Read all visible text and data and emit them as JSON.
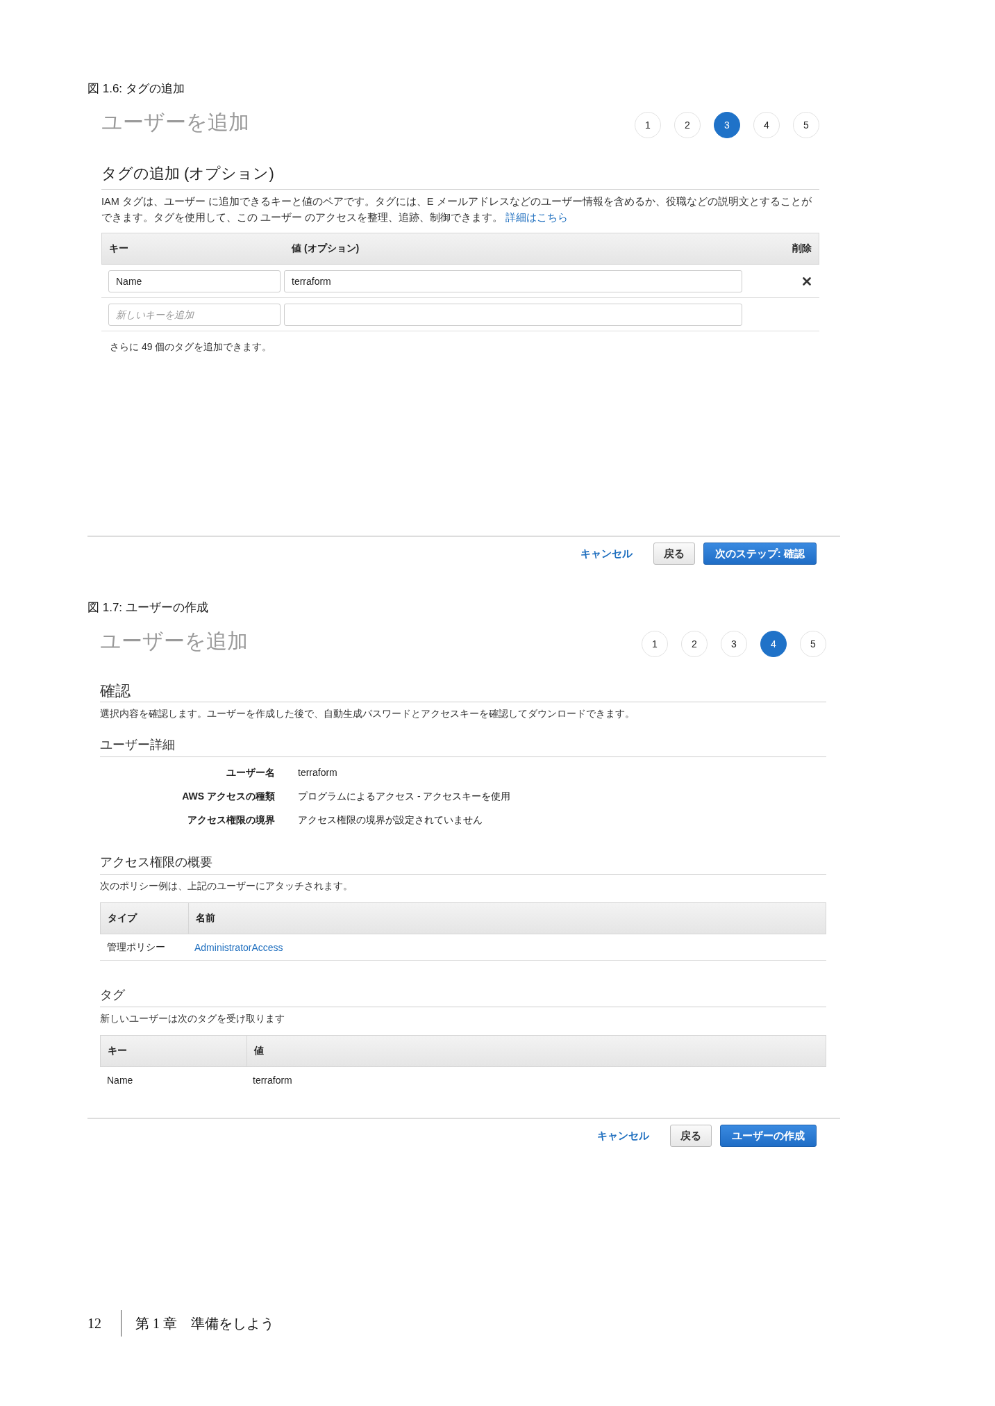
{
  "figures": [
    {
      "kind": "tags",
      "caption": "図 1.6: タグの追加",
      "title": "ユーザーを追加",
      "steps": [
        {
          "label": "1",
          "selected": false
        },
        {
          "label": "2",
          "selected": false
        },
        {
          "label": "3",
          "selected": true
        },
        {
          "label": "4",
          "selected": false
        },
        {
          "label": "5",
          "selected": false
        }
      ],
      "heading": "タグの追加 (オプション)",
      "description": "IAM タグは、ユーザー に追加できるキーと値のペアです。タグには、E メールアドレスなどのユーザー情報を含めるか、役職などの説明文とすることができます。タグを使用して、この ユーザー のアクセスを整理、追跡、制御できます。",
      "learn_more": "詳細はこちら",
      "columns": [
        "キー",
        "値 (オプション)",
        "削除"
      ],
      "rows": [
        {
          "key": "Name",
          "value": "terraform",
          "removable": true
        },
        {
          "key_placeholder": "新しいキーを追加",
          "removable": false
        }
      ],
      "note": "さらに 49 個のタグを追加できます。",
      "buttons": {
        "cancel": "キャンセル",
        "back": "戻る",
        "primary": "次のステップ: 確認"
      }
    },
    {
      "kind": "review",
      "caption": "図 1.7: ユーザーの作成",
      "title": "ユーザーを追加",
      "steps": [
        {
          "label": "1",
          "selected": false
        },
        {
          "label": "2",
          "selected": false
        },
        {
          "label": "3",
          "selected": false
        },
        {
          "label": "4",
          "selected": true
        },
        {
          "label": "5",
          "selected": false
        }
      ],
      "sections": [
        {
          "kind": "main",
          "heading": "確認",
          "text": "選択内容を確認します。ユーザーを作成した後で、自動生成パスワードとアクセスキーを確認してダウンロードできます。"
        },
        {
          "kind": "sub",
          "heading": "ユーザー詳細",
          "details": [
            {
              "label": "ユーザー名",
              "value": "terraform"
            },
            {
              "label": "AWS アクセスの種類",
              "value": "プログラムによるアクセス - アクセスキーを使用"
            },
            {
              "label": "アクセス権限の境界",
              "value": "アクセス権限の境界が設定されていません"
            }
          ]
        },
        {
          "kind": "sub",
          "heading": "アクセス権限の概要",
          "text": "次のポリシー例は、上記のユーザーにアタッチされます。",
          "table": {
            "columns": [
              "タイプ",
              "名前"
            ],
            "rows": [
              [
                {
                  "text": "管理ポリシー",
                  "link": false
                },
                {
                  "text": "AdministratorAccess",
                  "link": true
                }
              ]
            ]
          }
        },
        {
          "kind": "sub",
          "heading": "タグ",
          "text": "新しいユーザーは次のタグを受け取ります",
          "table": {
            "columns": [
              "キー",
              "値"
            ],
            "rows": [
              [
                {
                  "text": "Name",
                  "link": false
                },
                {
                  "text": "terraform",
                  "link": false
                }
              ]
            ]
          }
        }
      ],
      "buttons": {
        "cancel": "キャンセル",
        "back": "戻る",
        "primary": "ユーザーの作成"
      }
    }
  ],
  "footer": {
    "page_number": "12",
    "chapter": "第 1 章　準備をしよう"
  }
}
